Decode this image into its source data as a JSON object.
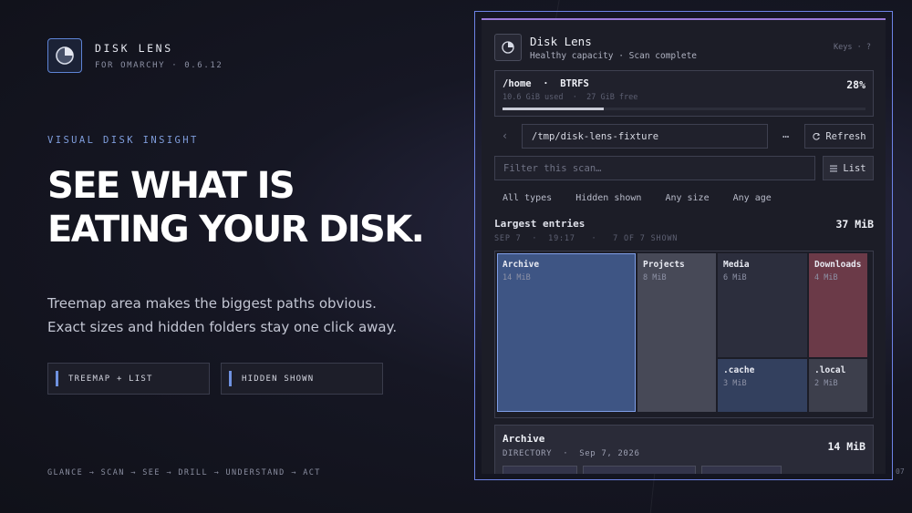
{
  "brand": {
    "title": "DISK LENS",
    "subtitle": "FOR OMARCHY · 0.6.12",
    "logo_icon": "pie-chart-icon",
    "accent": "#5e84d6"
  },
  "hero": {
    "eyebrow": "VISUAL DISK INSIGHT",
    "headline_line1": "SEE WHAT IS",
    "headline_line2": "EATING YOUR DISK.",
    "desc_line1": "Treemap area makes the biggest paths obvious.",
    "desc_line2": "Exact sizes and hidden folders stay one click away."
  },
  "chips": [
    {
      "label": "TREEMAP + LIST"
    },
    {
      "label": "HIDDEN SHOWN"
    }
  ],
  "flow": "GLANCE → SCAN → SEE → DRILL → UNDERSTAND → ACT",
  "corner_number": "07",
  "app": {
    "title": "Disk Lens",
    "status": "Healthy capacity · Scan complete",
    "keys_label": "Keys · ?",
    "volume": {
      "name": "/home  ·  BTRFS",
      "meta": "10.6 GiB used  ·  27 GiB free",
      "percent_label": "28%",
      "fraction_used": 0.28
    },
    "path": {
      "value": "/tmp/disk-lens-fixture"
    },
    "more_label": "…",
    "refresh_label": "Refresh",
    "filter": {
      "placeholder": "Filter this scan…"
    },
    "list_label": "List",
    "filters": [
      "All types",
      "Hidden shown",
      "Any size",
      "Any age"
    ],
    "section": {
      "title": "Largest entries",
      "total": "37 MiB",
      "meta": "SEP 7  ·  19:17   ·   7 OF 7 SHOWN"
    },
    "treemap": [
      {
        "name": "Archive",
        "size": "14 MiB",
        "color": "#3e5584",
        "selected": true
      },
      {
        "name": "Projects",
        "size": "8 MiB",
        "color": "#474957"
      },
      {
        "name": "Media",
        "size": "6 MiB",
        "color": "#2c2e3d"
      },
      {
        "name": "Downloads",
        "size": "4 MiB",
        "color": "#6b3a48"
      },
      {
        "name": ".cache",
        "size": "3 MiB",
        "color": "#33405e"
      },
      {
        "name": ".local",
        "size": "2 MiB",
        "color": "#3d3f4c"
      }
    ],
    "detail": {
      "name": "Archive",
      "meta": "DIRECTORY  ·  Sep 7, 2026",
      "size": "14 MiB"
    }
  }
}
